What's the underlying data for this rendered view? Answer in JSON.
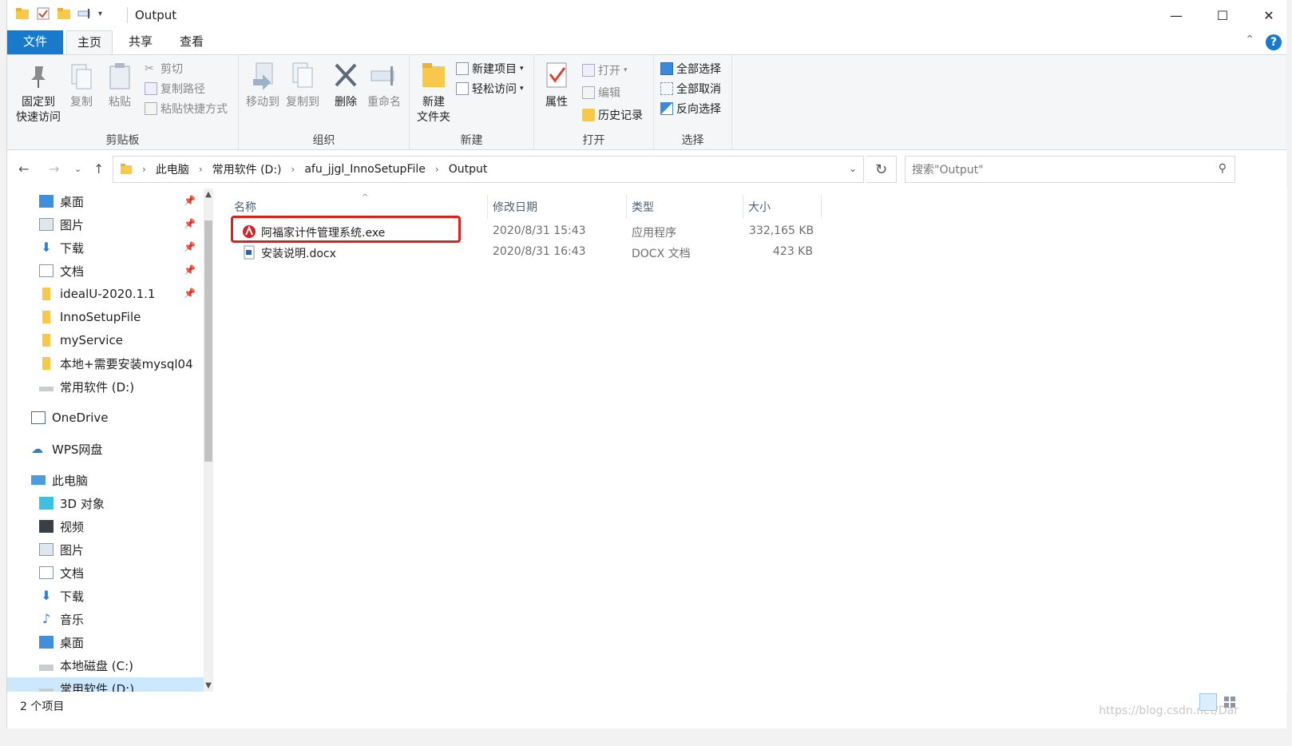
{
  "window": {
    "title": "Output",
    "controls": {
      "minimize": "—",
      "maximize": "☐",
      "close": "✕"
    }
  },
  "ribbon_tabs": [
    "文件",
    "主页",
    "共享",
    "查看"
  ],
  "ribbon": {
    "clipboard": {
      "label": "剪贴板",
      "pin_line1": "固定到",
      "pin_line2": "快速访问",
      "copy": "复制",
      "paste": "粘贴",
      "cut": "剪切",
      "copy_path": "复制路径",
      "paste_shortcut": "粘贴快捷方式"
    },
    "organize": {
      "label": "组织",
      "move_to": "移动到",
      "copy_to": "复制到",
      "delete": "删除",
      "rename": "重命名"
    },
    "new": {
      "label": "新建",
      "new_folder_line1": "新建",
      "new_folder_line2": "文件夹",
      "new_item": "新建项目",
      "easy_access": "轻松访问"
    },
    "open": {
      "label": "打开",
      "properties": "属性",
      "open": "打开",
      "edit": "编辑",
      "history": "历史记录"
    },
    "select": {
      "label": "选择",
      "select_all": "全部选择",
      "select_none": "全部取消",
      "invert": "反向选择"
    }
  },
  "breadcrumb": [
    "此电脑",
    "常用软件 (D:)",
    "afu_jjgl_InnoSetupFile",
    "Output"
  ],
  "search": {
    "placeholder": "搜索\"Output\""
  },
  "nav_pane": [
    {
      "label": "桌面",
      "pinned": true
    },
    {
      "label": "图片",
      "pinned": true
    },
    {
      "label": "下载",
      "pinned": true
    },
    {
      "label": "文档",
      "pinned": true
    },
    {
      "label": "idealU-2020.1.1",
      "pinned": true
    },
    {
      "label": "InnoSetupFile",
      "pinned": false
    },
    {
      "label": "myService",
      "pinned": false
    },
    {
      "label": "本地+需要安装mysql04",
      "pinned": false
    },
    {
      "label": "常用软件 (D:)",
      "pinned": false
    },
    {
      "label": "OneDrive",
      "pinned": false
    },
    {
      "label": "WPS网盘",
      "pinned": false
    },
    {
      "label": "此电脑",
      "pinned": false
    },
    {
      "label": "3D 对象",
      "pinned": false
    },
    {
      "label": "视频",
      "pinned": false
    },
    {
      "label": "图片",
      "pinned": false
    },
    {
      "label": "文档",
      "pinned": false
    },
    {
      "label": "下载",
      "pinned": false
    },
    {
      "label": "音乐",
      "pinned": false
    },
    {
      "label": "桌面",
      "pinned": false
    },
    {
      "label": "本地磁盘 (C:)",
      "pinned": false
    },
    {
      "label": "常用软件 (D:)",
      "pinned": false
    }
  ],
  "columns": [
    "名称",
    "修改日期",
    "类型",
    "大小"
  ],
  "files": [
    {
      "name": "阿福家计件管理系统.exe",
      "modified": "2020/8/31 15:43",
      "type": "应用程序",
      "size": "332,165 KB",
      "icon": "app-exe-icon"
    },
    {
      "name": "安装说明.docx",
      "modified": "2020/8/31 16:43",
      "type": "DOCX 文档",
      "size": "423 KB",
      "icon": "docx-icon"
    }
  ],
  "status": {
    "item_count": "2 个项目"
  },
  "watermark": "https://blog.csdn.net/Dar",
  "colors": {
    "accent": "#1979ca",
    "highlight_box": "#e01e1e",
    "selection": "#cce8ff"
  }
}
